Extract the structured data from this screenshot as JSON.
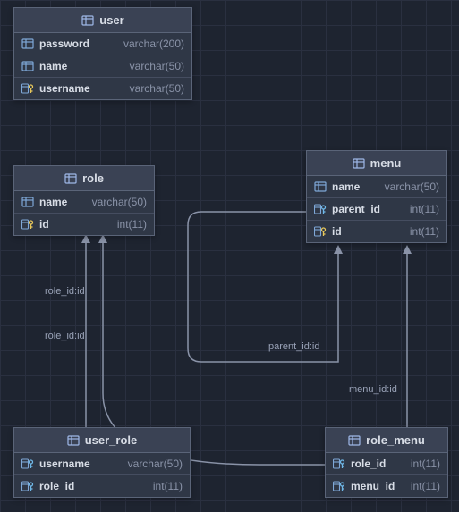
{
  "tables": {
    "user": {
      "title": "user",
      "cols": [
        {
          "icon": "col",
          "name": "password",
          "type": "varchar(200)"
        },
        {
          "icon": "col",
          "name": "name",
          "type": "varchar(50)"
        },
        {
          "icon": "key",
          "name": "username",
          "type": "varchar(50)"
        }
      ]
    },
    "role": {
      "title": "role",
      "cols": [
        {
          "icon": "col",
          "name": "name",
          "type": "varchar(50)"
        },
        {
          "icon": "key",
          "name": "id",
          "type": "int(11)"
        }
      ]
    },
    "menu": {
      "title": "menu",
      "cols": [
        {
          "icon": "col",
          "name": "name",
          "type": "varchar(50)"
        },
        {
          "icon": "fk",
          "name": "parent_id",
          "type": "int(11)"
        },
        {
          "icon": "key",
          "name": "id",
          "type": "int(11)"
        }
      ]
    },
    "user_role": {
      "title": "user_role",
      "cols": [
        {
          "icon": "fk",
          "name": "username",
          "type": "varchar(50)"
        },
        {
          "icon": "fk",
          "name": "role_id",
          "type": "int(11)"
        }
      ]
    },
    "role_menu": {
      "title": "role_menu",
      "cols": [
        {
          "icon": "fk",
          "name": "role_id",
          "type": "int(11)"
        },
        {
          "icon": "fk",
          "name": "menu_id",
          "type": "int(11)"
        }
      ]
    }
  },
  "rel_labels": {
    "role_id_1": "role_id:id",
    "role_id_2": "role_id:id",
    "parent_id": "parent_id:id",
    "menu_id": "menu_id:id"
  }
}
